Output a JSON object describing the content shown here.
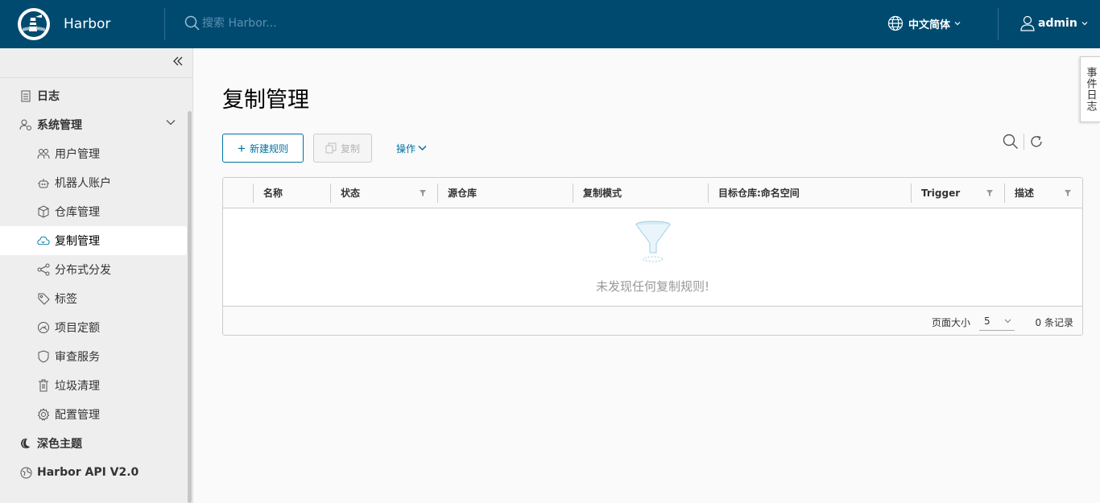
{
  "header": {
    "brand": "Harbor",
    "search_placeholder": "搜索 Harbor...",
    "language": "中文简体",
    "user": "admin"
  },
  "sidebar": {
    "items": [
      {
        "label": "日志",
        "icon": "log-icon"
      },
      {
        "label": "系统管理",
        "icon": "system-admin-icon"
      },
      {
        "label": "用户管理",
        "icon": "users-icon"
      },
      {
        "label": "机器人账户",
        "icon": "robot-icon"
      },
      {
        "label": "仓库管理",
        "icon": "registry-icon"
      },
      {
        "label": "复制管理",
        "icon": "cloud-replication-icon"
      },
      {
        "label": "分布式分发",
        "icon": "share-icon"
      },
      {
        "label": "标签",
        "icon": "tag-icon"
      },
      {
        "label": "项目定额",
        "icon": "quota-icon"
      },
      {
        "label": "审查服务",
        "icon": "shield-icon"
      },
      {
        "label": "垃圾清理",
        "icon": "trash-icon"
      },
      {
        "label": "配置管理",
        "icon": "gear-icon"
      },
      {
        "label": "深色主题",
        "icon": "moon-icon"
      },
      {
        "label": "Harbor API V2.0",
        "icon": "api-icon"
      }
    ],
    "active": "复制管理"
  },
  "main": {
    "title": "复制管理",
    "new_button": "新建规则",
    "copy_button": "复制",
    "actions_button": "操作"
  },
  "table": {
    "columns": [
      "名称",
      "状态",
      "源仓库",
      "复制模式",
      "目标仓库:命名空间",
      "Trigger",
      "描述"
    ],
    "empty_text": "未发现任何复制规则!",
    "page_size_label": "页面大小",
    "page_size": "5",
    "record_count": "0 条记录"
  },
  "event_log_tab": "事件日志",
  "colors": {
    "header_bg": "#004a70",
    "primary": "#0072a3",
    "sidebar_bg": "#eeeeee"
  }
}
